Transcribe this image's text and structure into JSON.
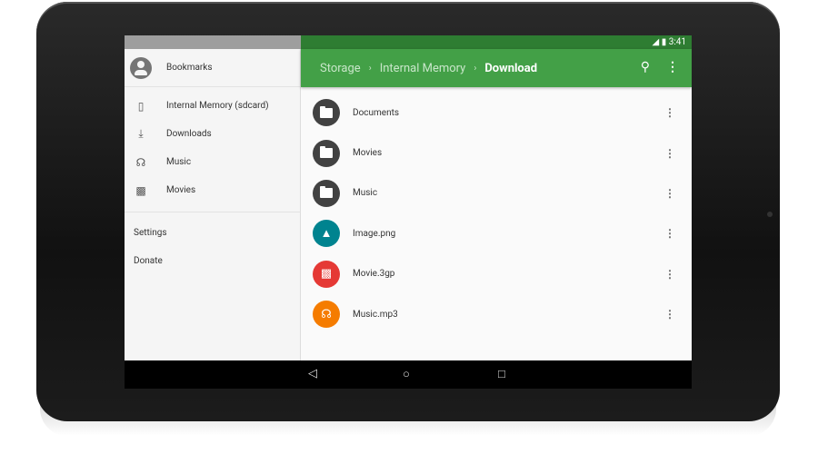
{
  "status": {
    "time": "3:41"
  },
  "drawer": {
    "header": "Bookmarks",
    "items": [
      {
        "label": "Internal Memory (sdcard)",
        "icon": "phone-icon"
      },
      {
        "label": "Downloads",
        "icon": "download-icon"
      },
      {
        "label": "Music",
        "icon": "headphones-icon"
      },
      {
        "label": "Movies",
        "icon": "movie-icon"
      }
    ],
    "secondary": [
      "Settings",
      "Donate"
    ]
  },
  "toolbar": {
    "breadcrumb": [
      "Storage",
      "Internal Memory",
      "Download"
    ],
    "accent": "#43a047"
  },
  "files": [
    {
      "name": "Documents",
      "type": "folder",
      "color": "#424242"
    },
    {
      "name": "Movies",
      "type": "folder",
      "color": "#424242"
    },
    {
      "name": "Music",
      "type": "folder",
      "color": "#424242"
    },
    {
      "name": "Image.png",
      "type": "image",
      "color": "#00838f"
    },
    {
      "name": "Movie.3gp",
      "type": "video",
      "color": "#e53935"
    },
    {
      "name": "Music.mp3",
      "type": "audio",
      "color": "#f57c00"
    }
  ]
}
